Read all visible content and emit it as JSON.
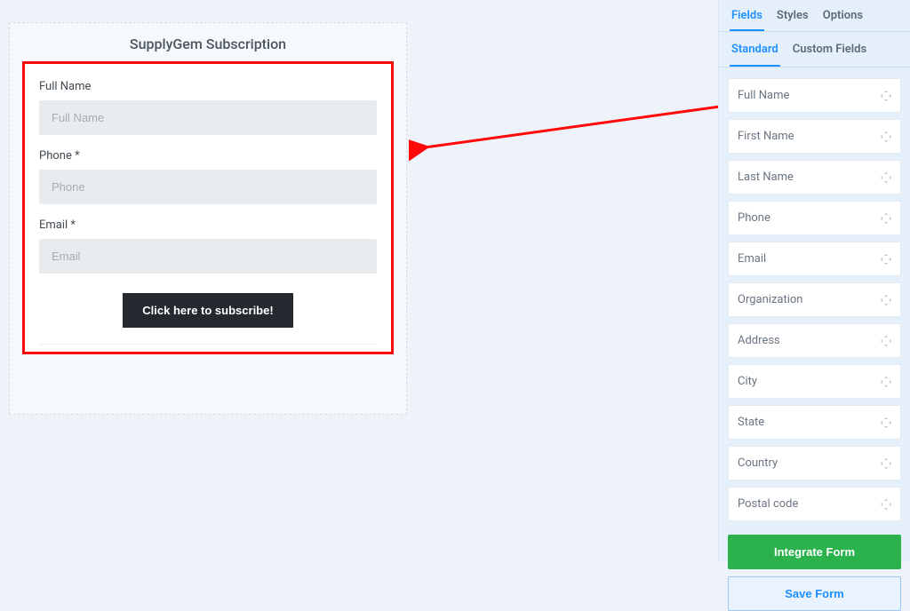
{
  "form": {
    "title": "SupplyGem Subscription",
    "fields": [
      {
        "label": "Full Name",
        "placeholder": "Full Name"
      },
      {
        "label": "Phone *",
        "placeholder": "Phone"
      },
      {
        "label": "Email *",
        "placeholder": "Email"
      }
    ],
    "submit_label": "Click here to subscribe!"
  },
  "annotation": {
    "arrow_color": "#ff0808"
  },
  "sidebar": {
    "primary_tabs": {
      "items": [
        "Fields",
        "Styles",
        "Options"
      ],
      "active": 0
    },
    "secondary_tabs": {
      "items": [
        "Standard",
        "Custom Fields"
      ],
      "active": 0
    },
    "field_palette": [
      "Full Name",
      "First Name",
      "Last Name",
      "Phone",
      "Email",
      "Organization",
      "Address",
      "City",
      "State",
      "Country",
      "Postal code"
    ],
    "actions": {
      "integrate": "Integrate Form",
      "save": "Save Form"
    }
  },
  "colors": {
    "accent": "#1e90ff",
    "success": "#2bb24c",
    "annotation": "#ff0808",
    "panel": "#e6f0fb"
  }
}
